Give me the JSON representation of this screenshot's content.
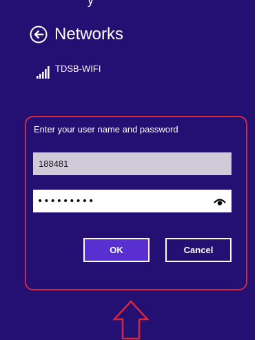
{
  "header": {
    "title": "Networks",
    "back_icon": "back-arrow-circle-icon",
    "top_sliver_text": "y"
  },
  "network": {
    "name": "TDSB-WIFI",
    "signal_icon": "wifi-signal-bars-icon"
  },
  "dialog": {
    "prompt": "Enter your user name and password",
    "username_value": "188481",
    "password_value": "•••••••••",
    "reveal_icon": "eye-reveal-icon",
    "ok_label": "OK",
    "cancel_label": "Cancel"
  },
  "annotation": {
    "arrow_icon": "up-arrow-outline-icon"
  },
  "colors": {
    "background": "#241072",
    "highlight_border": "#d9283b",
    "ok_button": "#5a2fd2",
    "username_field": "#cfcbd9"
  }
}
